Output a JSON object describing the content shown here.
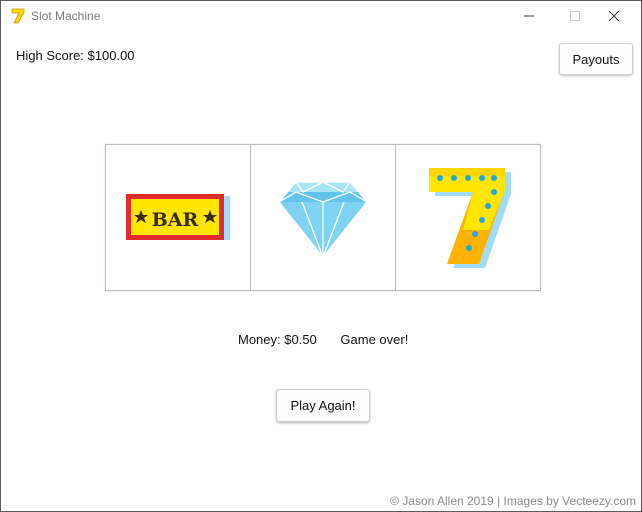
{
  "window": {
    "title": "Slot Machine"
  },
  "header": {
    "high_score": "High Score: $100.00",
    "payouts_label": "Payouts"
  },
  "reels": [
    {
      "symbol": "bar-icon",
      "label": "BAR"
    },
    {
      "symbol": "diamond-icon"
    },
    {
      "symbol": "seven-icon"
    }
  ],
  "status": {
    "money": "Money: $0.50",
    "message": "Game over!"
  },
  "actions": {
    "play_again_label": "Play Again!"
  },
  "footer": {
    "credits": "© Jason Allen 2019 | Images by Vecteezy.com"
  },
  "colors": {
    "bar_red": "#e02b2b",
    "bar_yellow": "#ffe600",
    "diamond_blue": "#7fd3f2",
    "seven_yellow": "#ffd400",
    "seven_orange": "#ffb100",
    "seven_dots": "#1fa7e0"
  }
}
